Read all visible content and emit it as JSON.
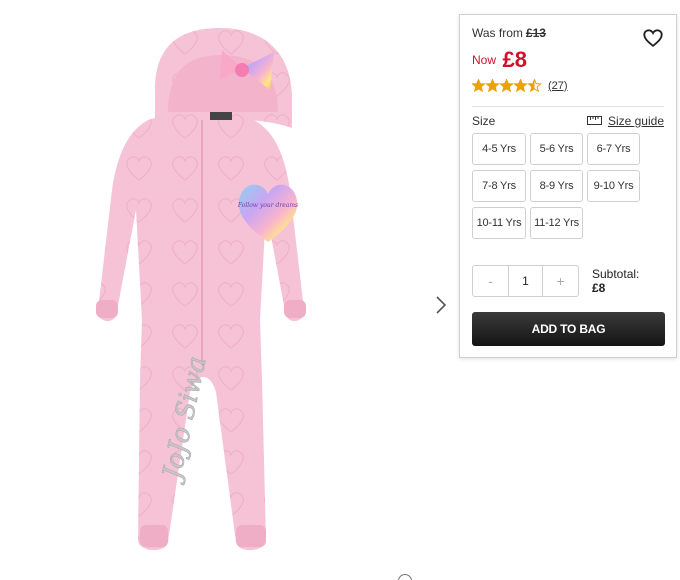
{
  "product": {
    "image_alt": "pink onesie",
    "print_text_top": "Follow your dreams",
    "leg_print_text": "JoJo Siwa"
  },
  "pricing": {
    "was_label": "Was from",
    "was_price": "£13",
    "now_label": "Now",
    "now_price": "£8",
    "rating_value": 4.5,
    "rating_max": 5,
    "review_count": "(27)"
  },
  "size": {
    "label": "Size",
    "guide_label": "Size guide",
    "options": [
      "4-5 Yrs",
      "5-6 Yrs",
      "6-7 Yrs",
      "7-8 Yrs",
      "8-9 Yrs",
      "9-10 Yrs",
      "10-11 Yrs",
      "11-12 Yrs"
    ]
  },
  "quantity": {
    "minus": "-",
    "value": "1",
    "plus": "+"
  },
  "subtotal": {
    "label": "Subtotal:",
    "amount": "£8"
  },
  "cta": {
    "add_to_bag": "ADD TO BAG"
  },
  "colors": {
    "price_red": "#d0112b",
    "star": "#e8a20c",
    "garment_pink": "#f6c3d6"
  },
  "icons": {
    "wishlist": "heart-outline-icon",
    "next": "chevron-right-icon",
    "size_guide": "ruler-icon"
  }
}
